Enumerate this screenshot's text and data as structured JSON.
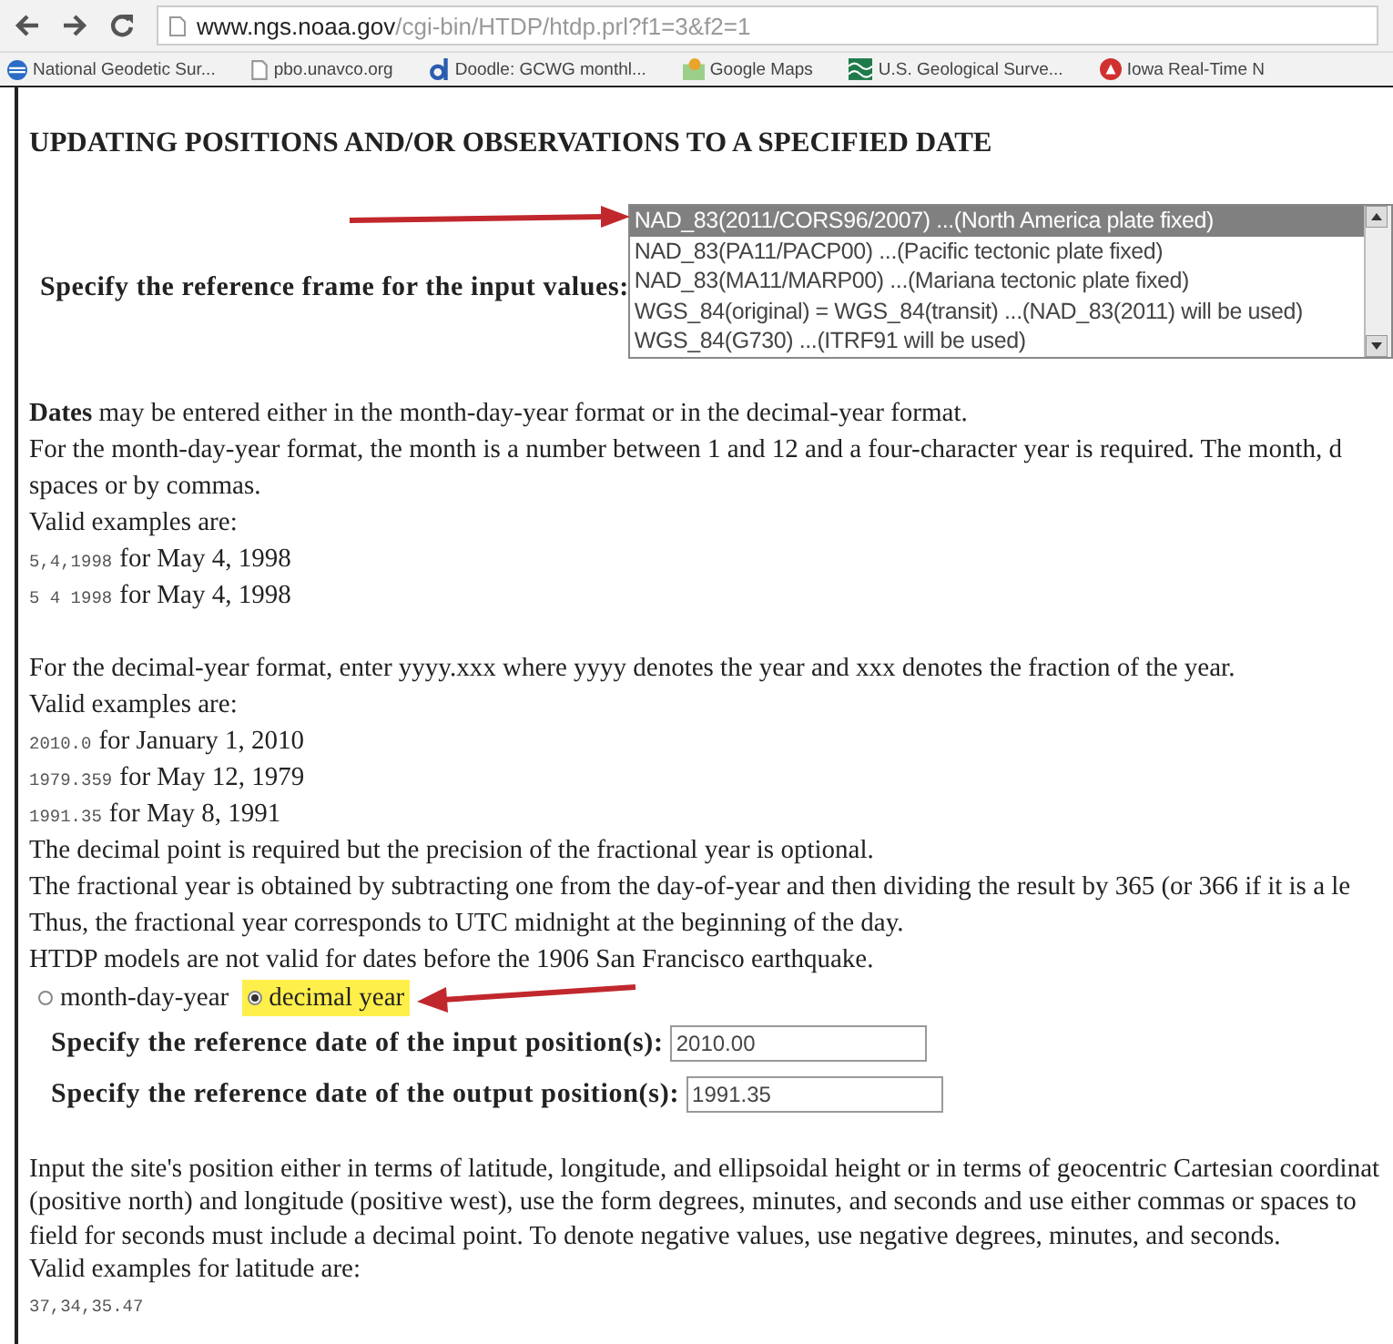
{
  "browser": {
    "url_host": "www.ngs.noaa.gov",
    "url_path": "/cgi-bin/HTDP/htdp.prl?f1=3&f2=1"
  },
  "bookmarks": [
    {
      "label": "National Geodetic Sur..."
    },
    {
      "label": "pbo.unavco.org"
    },
    {
      "label": "Doodle: GCWG monthl..."
    },
    {
      "label": "Google Maps"
    },
    {
      "label": "U.S. Geological Surve..."
    },
    {
      "label": "Iowa Real-Time N"
    }
  ],
  "title": "UPDATING POSITIONS AND/OR OBSERVATIONS TO A SPECIFIED DATE",
  "reference_frame": {
    "label": "Specify the reference frame for the input values:",
    "options": [
      {
        "label": "NAD_83(2011/CORS96/2007) ...(North America plate fixed)",
        "selected": true
      },
      {
        "label": "NAD_83(PA11/PACP00) ...(Pacific tectonic plate fixed)",
        "selected": false
      },
      {
        "label": "NAD_83(MA11/MARP00) ...(Mariana tectonic plate fixed)",
        "selected": false
      },
      {
        "label": "WGS_84(original) = WGS_84(transit) ...(NAD_83(2011) will be used)",
        "selected": false
      },
      {
        "label": "WGS_84(G730) ...(ITRF91 will be used)",
        "selected": false
      }
    ]
  },
  "dates_text": [
    {
      "kind": "line",
      "text": "**Dates** may be entered either in the month-day-year format or in the decimal-year format."
    },
    {
      "kind": "line",
      "text": "For the month-day-year format, the month is a number between 1 and 12 and a four-character year is required. The month, d"
    },
    {
      "kind": "line",
      "text": "spaces or by commas."
    },
    {
      "kind": "line",
      "text": "Valid examples are:"
    },
    {
      "kind": "example",
      "code": "5,4,1998",
      "text": "for May 4, 1998"
    },
    {
      "kind": "example",
      "code": "5 4 1998",
      "text": "for May 4, 1998"
    },
    {
      "kind": "gap"
    },
    {
      "kind": "line",
      "text": "For the decimal-year format, enter yyyy.xxx where yyyy denotes the year and xxx denotes the fraction of the year."
    },
    {
      "kind": "line",
      "text": "Valid examples are:"
    },
    {
      "kind": "example",
      "code": "2010.0",
      "text": "for January 1, 2010"
    },
    {
      "kind": "example",
      "code": "1979.359",
      "text": "for May 12, 1979"
    },
    {
      "kind": "example",
      "code": "1991.35",
      "text": "for May 8, 1991"
    },
    {
      "kind": "line",
      "text": "The decimal point is required but the precision of the fractional year is optional."
    },
    {
      "kind": "line",
      "text": "The fractional year is obtained by subtracting one from the day-of-year and then dividing the result by 365 (or 366 if it is a le"
    },
    {
      "kind": "line",
      "text": "Thus, the fractional year corresponds to UTC midnight at the beginning of the day."
    },
    {
      "kind": "line",
      "text": "HTDP models are not valid for dates before the 1906 San Francisco earthquake."
    }
  ],
  "date_format": [
    {
      "label": "month-day-year",
      "selected": false,
      "highlighted": false
    },
    {
      "label": "decimal year",
      "selected": true,
      "highlighted": true
    }
  ],
  "date_fields": [
    {
      "label": "Specify the reference date of the input position(s):",
      "value": "2010.00"
    },
    {
      "label": "Specify the reference date of the output position(s):",
      "value": "1991.35"
    }
  ],
  "position_text": [
    {
      "kind": "line",
      "text": "Input the site's position either in terms of latitude, longitude, and ellipsoidal height or in terms of geocentric Cartesian coordinat"
    },
    {
      "kind": "line",
      "text": "(positive north) and longitude (positive west), use the form degrees, minutes, and seconds and use either commas or spaces to"
    },
    {
      "kind": "line",
      "text": "field for seconds must include a decimal point. To denote negative values, use negative degrees, minutes, and seconds."
    },
    {
      "kind": "line",
      "text": "Valid examples for latitude are:"
    },
    {
      "kind": "example",
      "code": "37,34,35.47"
    }
  ]
}
